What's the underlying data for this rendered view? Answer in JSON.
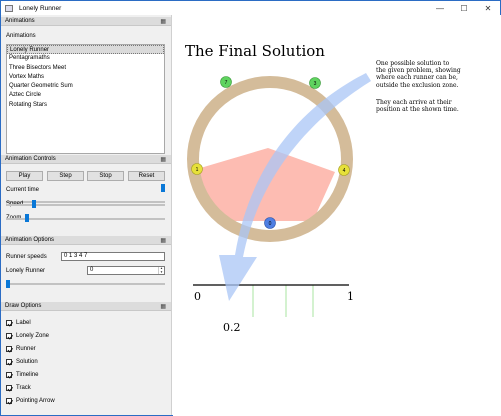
{
  "window": {
    "title": "Lonely Runner",
    "buttons": [
      "—",
      "☐",
      "✕"
    ]
  },
  "left_panel": {
    "animations_section": {
      "header": "Animations",
      "list_label": "Animations",
      "items": [
        "Lonely Runner",
        "Pentagramaths",
        "Three Bisectors Meet",
        "Vortex Maths",
        "Quarter Geometric Sum",
        "Aztec Circle",
        "Rotating Stars"
      ],
      "selected_index": 0
    },
    "controls_section": {
      "header": "Animation Controls",
      "play": "Play",
      "step": "Step",
      "stop": "Stop",
      "reset": "Reset",
      "current_time_label": "Current time",
      "speed_label": "Speed",
      "zoom_label": "Zoom",
      "current_time_level": 1.0,
      "speed_level": 0.17,
      "zoom_level": 0.0
    },
    "options_section": {
      "header": "Animation Options",
      "runner_speeds_label": "Runner speeds",
      "runner_speeds_value": "0 1 3 4 7",
      "lonely_runner_label": "Lonely Runner",
      "lonely_runner_value": "0",
      "slider_level": 0.0
    },
    "draw_section": {
      "header": "Draw Options",
      "items": [
        "Label",
        "Lonely Zone",
        "Runner",
        "Solution",
        "Timeline",
        "Track",
        "Pointing Arrow"
      ]
    }
  },
  "canvas": {
    "title": "The Final Solution",
    "note_1": [
      "One possible solution to",
      "the given problem, showing",
      "where each runner can be,",
      "outside the exclusion zone."
    ],
    "note_2": [
      "They each arrive at their",
      "position at the shown time."
    ],
    "runners": [
      {
        "label": "7",
        "color": "#5fd35f"
      },
      {
        "label": "3",
        "color": "#5fd35f"
      },
      {
        "label": "1",
        "color": "#e6e03a"
      },
      {
        "label": "4",
        "color": "#e6e03a"
      },
      {
        "label": "0",
        "color": "#4f7fe3"
      }
    ],
    "timeline": {
      "start": "0",
      "end": "1",
      "marker": "0.2"
    },
    "colors": {
      "track": "#d4bc9a",
      "zone": "#fdbcb2",
      "arrow": "#a9c5f5",
      "tick": "#a8e6a0"
    }
  }
}
